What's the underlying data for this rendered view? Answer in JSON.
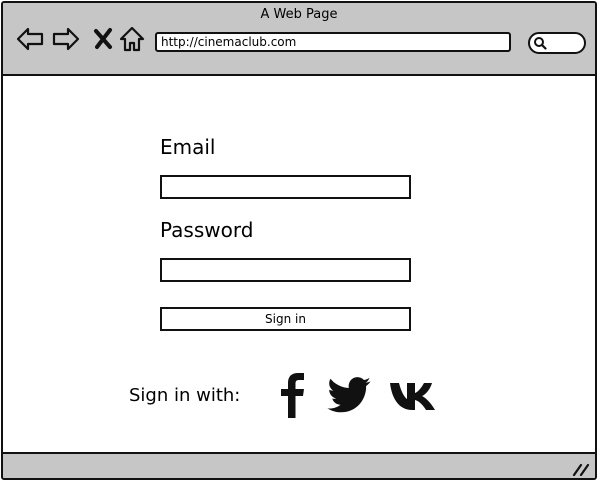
{
  "window": {
    "title": "A Web Page"
  },
  "browser": {
    "url": "http://cinemaclub.com",
    "icons": [
      "back-arrow-icon",
      "forward-arrow-icon",
      "close-x-icon",
      "home-icon",
      "search-icon",
      "resize-grip-icon"
    ]
  },
  "form": {
    "email_label": "Email",
    "email_value": "",
    "password_label": "Password",
    "password_value": "",
    "signin_label": "Sign in"
  },
  "social": {
    "label": "Sign in with:",
    "providers": [
      "facebook",
      "twitter",
      "vk"
    ]
  }
}
